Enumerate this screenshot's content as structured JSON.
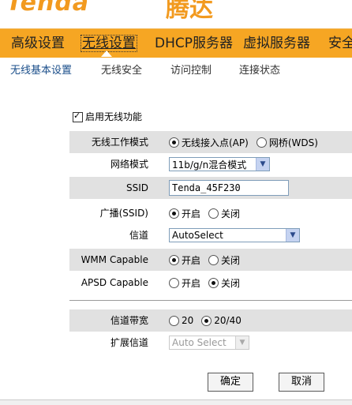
{
  "brand": {
    "logo": "Tenda",
    "logo_cn": "腾达"
  },
  "main_nav": [
    {
      "label": "高级设置"
    },
    {
      "label": "无线设置"
    },
    {
      "label": "DHCP服务器"
    },
    {
      "label": "虚拟服务器"
    },
    {
      "label": "安全"
    }
  ],
  "sub_nav": [
    {
      "label": "无线基本设置"
    },
    {
      "label": "无线安全"
    },
    {
      "label": "访问控制"
    },
    {
      "label": "连接状态"
    }
  ],
  "form": {
    "enable_wireless": {
      "label": "启用无线功能",
      "checked": true
    },
    "work_mode": {
      "label": "无线工作模式",
      "options": [
        "无线接入点(AP)",
        "网桥(WDS)"
      ],
      "selected": "无线接入点(AP)"
    },
    "network_mode": {
      "label": "网络模式",
      "value": "11b/g/n混合模式"
    },
    "ssid": {
      "label": "SSID",
      "value": "Tenda_45F230"
    },
    "broadcast": {
      "label": "广播(SSID)",
      "options": [
        "开启",
        "关闭"
      ],
      "selected": "开启"
    },
    "channel": {
      "label": "信道",
      "value": "AutoSelect"
    },
    "wmm": {
      "label": "WMM Capable",
      "options": [
        "开启",
        "关闭"
      ],
      "selected": "开启"
    },
    "apsd": {
      "label": "APSD Capable",
      "options": [
        "开启",
        "关闭"
      ],
      "selected": "关闭"
    },
    "bandwidth": {
      "label": "信道带宽",
      "options": [
        "20",
        "20/40"
      ],
      "selected": "20/40"
    },
    "ext_channel": {
      "label": "扩展信道",
      "value": "Auto Select"
    }
  },
  "buttons": {
    "ok": "确定",
    "cancel": "取消"
  }
}
